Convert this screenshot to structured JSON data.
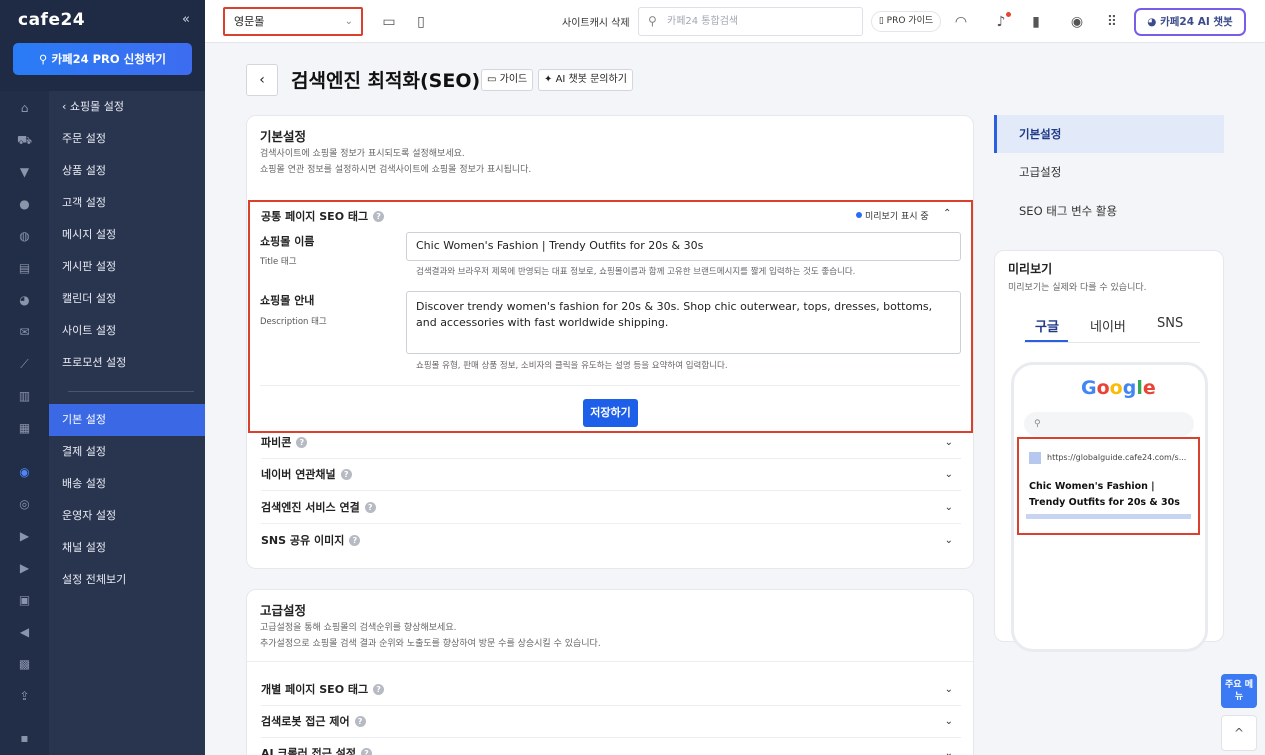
{
  "brand": {
    "logo": "cafe24",
    "collapse_icon": "«"
  },
  "pro_button": "카페24 PRO 신청하기",
  "rail_icons": [
    "home-icon",
    "cart-icon",
    "shirt-icon",
    "user-icon",
    "chat-icon",
    "board-icon",
    "palette-icon",
    "mail-icon",
    "chart-icon",
    "calendar-icon",
    "bar-icon",
    "pin-icon",
    "globe-icon",
    "truck-icon",
    "play-icon",
    "bag-icon",
    "megaphone-icon",
    "store-icon",
    "app-icon",
    "grid-icon"
  ],
  "menu": {
    "back": "쇼핑몰 설정",
    "items": [
      "주문 설정",
      "상품 설정",
      "고객 설정",
      "메시지 설정",
      "게시판 설정",
      "캘린더 설정",
      "사이트 설정",
      "프로모션 설정"
    ],
    "items2": [
      "기본 설정",
      "결제 설정",
      "배송 설정",
      "운영자 설정",
      "채널 설정",
      "설정 전체보기"
    ],
    "active": "기본 설정"
  },
  "topbar": {
    "language": "영문몰",
    "cache_delete": "사이트캐시 삭제",
    "search_placeholder": "카페24 통합검색",
    "pro_guide": "PRO 가이드",
    "ai_chatbot": "카페24 AI 챗봇"
  },
  "page": {
    "title": "검색엔진 최적화(SEO)",
    "guide": "가이드",
    "ai_ask": "AI 챗봇 문의하기"
  },
  "basic": {
    "title": "기본설정",
    "desc1": "검색사이트에 쇼핑몰 정보가 표시되도록 설정해보세요.",
    "desc2": "쇼핑몰 연관 정보를 설정하시면 검색사이트에 쇼핑몰 정보가 표시됩니다.",
    "common_tag_title": "공통 페이지 SEO 태그",
    "preview_status": "미리보기 표시 중",
    "name_label": "쇼핑몰 이름",
    "name_sub": "Title 태그",
    "name_value": "Chic Women's Fashion | Trendy Outfits for 20s & 30s",
    "name_hint": "검색결과와 브라우저 제목에 반영되는 대표 정보로, 쇼핑몰이름과 함께 고유한 브랜드메시지를 짧게 입력하는 것도 좋습니다.",
    "desc_label": "쇼핑몰 안내",
    "desc_sub": "Description 태그",
    "desc_value": "Discover trendy women's fashion for 20s & 30s. Shop chic outerwear, tops, dresses, bottoms, and accessories with fast worldwide shipping.",
    "desc_hint": "쇼핑몰 유형, 판매 상품 정보, 소비자의 클릭을 유도하는 설명 등을 요약하여 입력합니다.",
    "save": "저장하기",
    "rows": [
      "파비콘",
      "네이버 연관채널",
      "검색엔진 서비스 연결",
      "SNS 공유 이미지"
    ]
  },
  "advanced": {
    "title": "고급설정",
    "desc1": "고급설정을 통해 쇼핑몰의 검색순위를 향상해보세요.",
    "desc2": "추가설정으로 쇼핑몰 검색 결과 순위와 노출도를 향상하여 방문 수를 상승시킬 수 있습니다.",
    "rows": [
      "개별 페이지 SEO 태그",
      "검색로봇 접근 제어",
      "AI 크롤러 접근 설정"
    ]
  },
  "right_nav": [
    "기본설정",
    "고급설정",
    "SEO 태그 변수 활용"
  ],
  "preview": {
    "title": "미리보기",
    "desc": "미리보기는 실제와 다를 수 있습니다.",
    "tabs": [
      "구글",
      "네이버",
      "SNS"
    ],
    "google_logo": "Google",
    "serp_url": "https://globalguide.cafe24.com/s...",
    "serp_title": "Chic Women's Fashion | Trendy Outfits for 20s & 30s"
  },
  "floating": {
    "key_menu": "주요 메뉴",
    "top": "^"
  },
  "colors": {
    "accent": "#2a5fe0",
    "highlight": "#d9412e",
    "sidebar": "#1f2a44"
  }
}
